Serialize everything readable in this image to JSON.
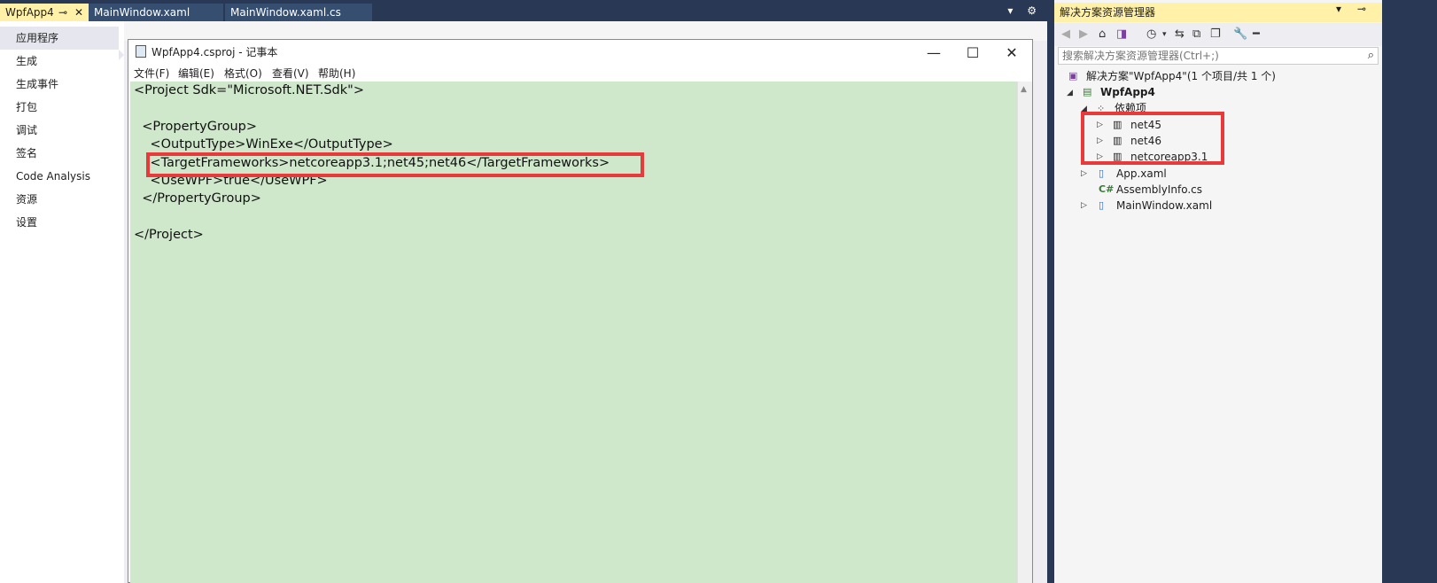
{
  "tabs": [
    {
      "label": "WpfApp4",
      "pin": "⊸",
      "close": "✕",
      "active": true
    },
    {
      "label": "MainWindow.xaml",
      "active": false
    },
    {
      "label": "MainWindow.xaml.cs",
      "active": false
    }
  ],
  "tab_controls": "▾ ⚙",
  "nav": {
    "items": [
      "应用程序",
      "生成",
      "生成事件",
      "打包",
      "调试",
      "签名",
      "Code Analysis",
      "资源",
      "设置"
    ],
    "selected": "应用程序"
  },
  "notepad": {
    "title": "WpfApp4.csproj - 记事本",
    "controls": {
      "minimize": "—",
      "maximize": "☐",
      "close": "✕"
    },
    "menu": [
      "文件(F)",
      "编辑(E)",
      "格式(O)",
      "查看(V)",
      "帮助(H)"
    ],
    "lines": [
      "<Project Sdk=\"Microsoft.NET.Sdk\">",
      "",
      "  <PropertyGroup>",
      "    <OutputType>WinExe</OutputType>",
      "    <TargetFrameworks>netcoreapp3.1;net45;net46</TargetFrameworks>",
      "    <UseWPF>true</UseWPF>",
      "  </PropertyGroup>",
      "",
      "</Project>"
    ]
  },
  "solution_explorer": {
    "title": "解决方案资源管理器",
    "title_controls": "▾ ⊸ ✕",
    "search_placeholder": "搜索解决方案资源管理器(Ctrl+;)",
    "tree": {
      "solution": "解决方案\"WpfApp4\"(1 个项目/共 1 个)",
      "project": "WpfApp4",
      "dependencies": "依赖项",
      "frameworks": [
        "net45",
        "net46",
        "netcoreapp3.1"
      ],
      "files": [
        "App.xaml",
        "AssemblyInfo.cs",
        "MainWindow.xaml"
      ]
    }
  },
  "colors": {
    "highlight": "#e83a3a",
    "editor_bg": "#cfe8cb",
    "vs_blue": "#293955",
    "active_tab": "#fff1a8"
  }
}
